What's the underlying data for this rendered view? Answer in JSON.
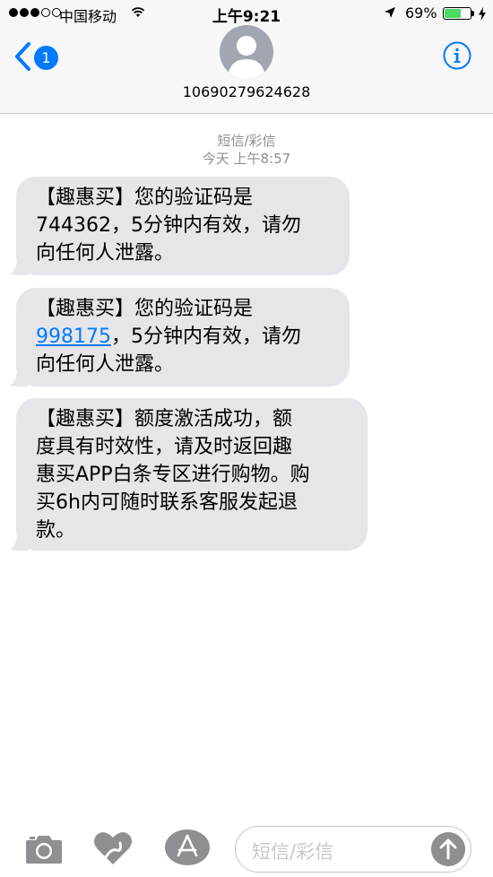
{
  "status_bar": {
    "carrier": "中国移动",
    "time": "上午9:21",
    "battery_percent": "69%",
    "battery_level": 0.69,
    "icons": [
      "signal-dots",
      "wifi-icon",
      "location-arrow-icon",
      "battery-icon",
      "charging-bolt-icon"
    ]
  },
  "nav": {
    "back_badge": "1",
    "contact": "10690279624628",
    "icons": [
      "back-chevron-icon",
      "avatar-silhouette",
      "info-icon"
    ]
  },
  "thread": {
    "service": "短信/彩信",
    "timestamp": "今天 上午8:57"
  },
  "messages": [
    {
      "lines": [
        "【趣惠买】您的验证码是",
        "744362，5分钟内有效，请勿",
        "向任何人泄露。"
      ]
    },
    {
      "code_link": "998175",
      "line1": "【趣惠买】您的验证码是",
      "line2_rest": "，5分钟内有效，请勿",
      "line3": "向任何人泄露。"
    },
    {
      "lines": [
        "【趣惠买】额度激活成功，额",
        "度具有时效性，请及时返回趣",
        "惠买APP白条专区进行购物。购",
        "买6h内可随时联系客服发起退",
        "款。"
      ]
    }
  ],
  "input_bar": {
    "placeholder": "短信/彩信",
    "icons": [
      "camera-icon",
      "digital-touch-icon",
      "app-store-icon",
      "send-arrow-icon"
    ]
  },
  "colors": {
    "accent": "#007aff",
    "bubble": "#e5e5ea",
    "battery": "#4cd964",
    "meta_text": "#8e8e93"
  }
}
